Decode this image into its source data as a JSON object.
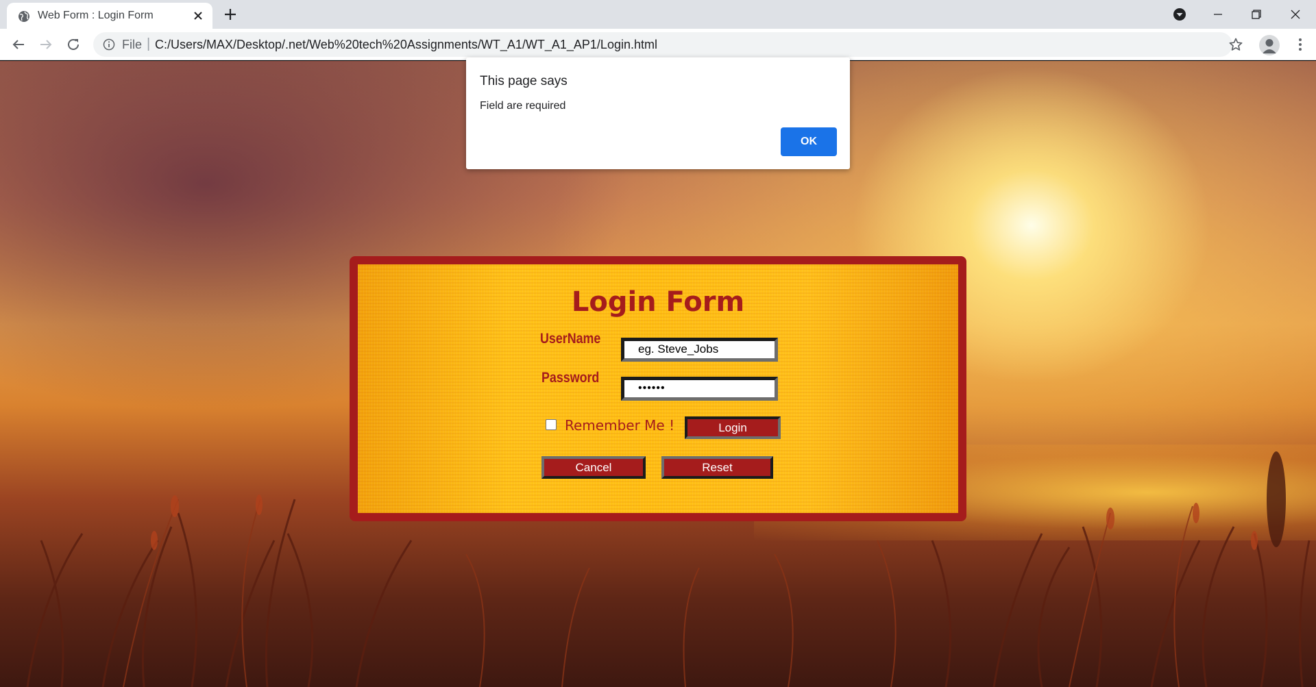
{
  "browser": {
    "tab_title": "Web Form : Login Form",
    "address_scheme": "File",
    "address_url": "C:/Users/MAX/Desktop/.net/Web%20tech%20Assignments/WT_A1/WT_A1_AP1/Login.html",
    "icons": {
      "favicon": "globe-icon",
      "tab_close": "close-icon",
      "new_tab": "plus-icon",
      "profile_menu": "chevron-down-circle-icon",
      "back": "arrow-left-icon",
      "forward": "arrow-right-icon",
      "reload": "reload-icon",
      "site_info": "info-icon",
      "bookmark": "star-icon",
      "account": "person-icon",
      "menu": "vertical-dots-icon"
    }
  },
  "alert": {
    "title": "This page says",
    "message": "Field are required",
    "ok_label": "OK"
  },
  "login_form": {
    "title": "Login Form",
    "username_label": "UserName",
    "username_value": "eg. Steve_Jobs",
    "password_label": "Password",
    "password_value": "••••••",
    "remember_label": "Remember Me !",
    "remember_checked": false,
    "login_label": "Login",
    "cancel_label": "Cancel",
    "reset_label": "Reset"
  },
  "colors": {
    "form_border": "#a51c1c",
    "form_panel": "#ffc018",
    "button_fill": "#a51c1c",
    "dialog_ok": "#1a73e8"
  }
}
